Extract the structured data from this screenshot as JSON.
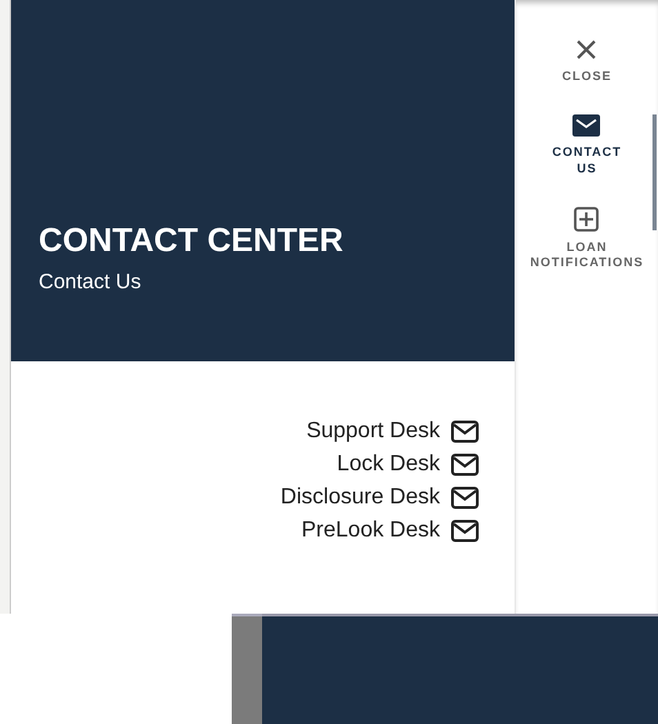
{
  "header": {
    "title": "CONTACT CENTER",
    "subtitle": "Contact Us"
  },
  "desks": [
    {
      "label": "Support Desk"
    },
    {
      "label": "Lock Desk"
    },
    {
      "label": "Disclosure Desk"
    },
    {
      "label": "PreLook Desk"
    }
  ],
  "sidebar": {
    "items": [
      {
        "kind": "close",
        "label": "CLOSE",
        "selected": false
      },
      {
        "kind": "mail",
        "label": "CONTACT US",
        "selected": true
      },
      {
        "kind": "plus",
        "label": "LOAN NOTIFICATIONS",
        "selected": false
      }
    ]
  }
}
